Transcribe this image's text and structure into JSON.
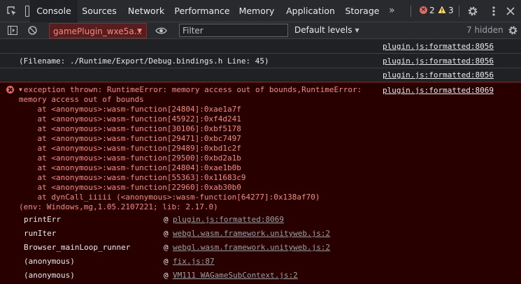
{
  "tabs": [
    {
      "label": "Console",
      "active": true
    },
    {
      "label": "Sources"
    },
    {
      "label": "Network"
    },
    {
      "label": "Performance"
    },
    {
      "label": "Memory"
    },
    {
      "label": "Application"
    },
    {
      "label": "Storage"
    }
  ],
  "more_tabs": "»",
  "errors_count": "2",
  "warnings_count": "3",
  "toolbar": {
    "context": "gamePlugin_wxe5a...",
    "filter_placeholder": "Filter",
    "levels": "Default levels",
    "hidden": "7 hidden"
  },
  "console": {
    "rows": [
      {
        "message": "",
        "source": "plugin.js:formatted:8056"
      },
      {
        "message": "(Filename: ./Runtime/Export/Debug.bindings.h Line: 45)",
        "source": "plugin.js:formatted:8056"
      },
      {
        "message": "",
        "source": "plugin.js:formatted:8056"
      }
    ],
    "error": {
      "source": "plugin.js:formatted:8069",
      "lines": [
        "exception thrown: RuntimeError: memory access out of bounds,RuntimeError:",
        "memory access out of bounds",
        "    at <anonymous>:wasm-function[24804]:0xae1a7f",
        "    at <anonymous>:wasm-function[45922]:0xf4d241",
        "    at <anonymous>:wasm-function[30106]:0xbf5178",
        "    at <anonymous>:wasm-function[29471]:0xbc7497",
        "    at <anonymous>:wasm-function[29489]:0xbd1c2f",
        "    at <anonymous>:wasm-function[29500]:0xbd2a1b",
        "    at <anonymous>:wasm-function[24804]:0xae1b0b",
        "    at <anonymous>:wasm-function[55363]:0x11683c9",
        "    at <anonymous>:wasm-function[22960]:0xab30b0",
        "    at dynCall_iiiii (<anonymous>:wasm-function[64277]:0x138af70)",
        "(env: Windows,mg,1.05.2107221; lib: 2.17.0)"
      ],
      "stack": [
        {
          "fn": "printErr",
          "at": "@",
          "link": "plugin.js:formatted:8069"
        },
        {
          "fn": "runIter",
          "at": "@",
          "link": "webgl.wasm.framework.unityweb.js:2"
        },
        {
          "fn": "Browser_mainLoop_runner",
          "at": "@",
          "link": "webgl.wasm.framework.unityweb.js:2"
        },
        {
          "fn": "(anonymous)",
          "at": "@",
          "link": "fix.js:87"
        },
        {
          "fn": "(anonymous)",
          "at": "@",
          "link": "VM111 WAGameSubContext.js:2"
        }
      ]
    }
  },
  "colors": {
    "error_text": "#f28b82",
    "error_bg": "#290000",
    "panel_bg": "#202124"
  }
}
